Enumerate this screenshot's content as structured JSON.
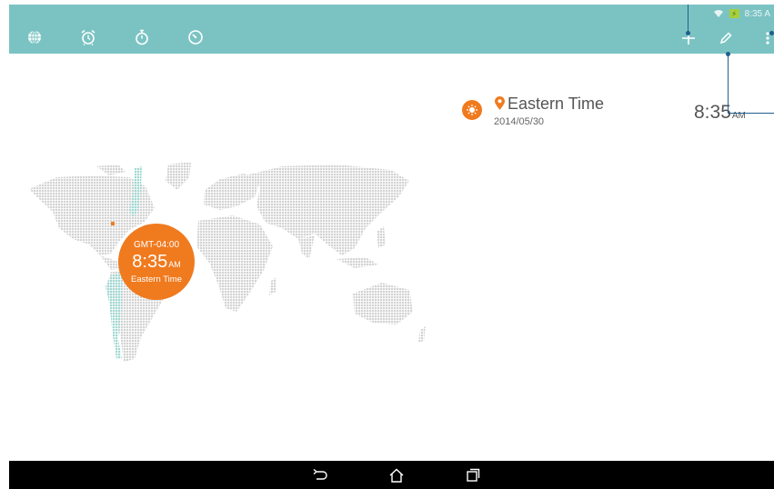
{
  "status_bar": {
    "time": "8:35 A",
    "wifi_icon": "wifi-icon",
    "battery_icon": "battery-charging-icon",
    "battery_glyph": "⚡"
  },
  "app_bar": {
    "color": "#7bc3c3",
    "tabs": [
      {
        "name": "world-clock",
        "icon": "globe-icon",
        "selected": true
      },
      {
        "name": "alarm",
        "icon": "alarm-clock-icon",
        "selected": false
      },
      {
        "name": "stopwatch",
        "icon": "stopwatch-icon",
        "selected": false
      },
      {
        "name": "timer",
        "icon": "timer-icon",
        "selected": false
      }
    ],
    "actions": [
      {
        "name": "add",
        "icon": "plus-icon"
      },
      {
        "name": "edit",
        "icon": "pencil-icon"
      },
      {
        "name": "more",
        "icon": "more-vert-icon"
      }
    ]
  },
  "timezone_list": [
    {
      "name": "Eastern Time",
      "date": "2014/05/30",
      "time": "8:35",
      "ampm": "AM",
      "day_icon": "sun-icon",
      "location_icon": "location-pin-icon"
    }
  ],
  "map_bubble": {
    "gmt": "GMT-04:00",
    "time": "8:35",
    "ampm": "AM",
    "zone": "Eastern Time",
    "color": "#f07a1e"
  },
  "nav_bar": {
    "buttons": [
      "back-icon",
      "home-icon",
      "recents-icon"
    ]
  },
  "accent_colors": {
    "orange": "#f07a1e",
    "map_gray": "#d6d6d6",
    "highlight_teal": "#9fd8d2",
    "callout_blue": "#1f5f8f"
  }
}
